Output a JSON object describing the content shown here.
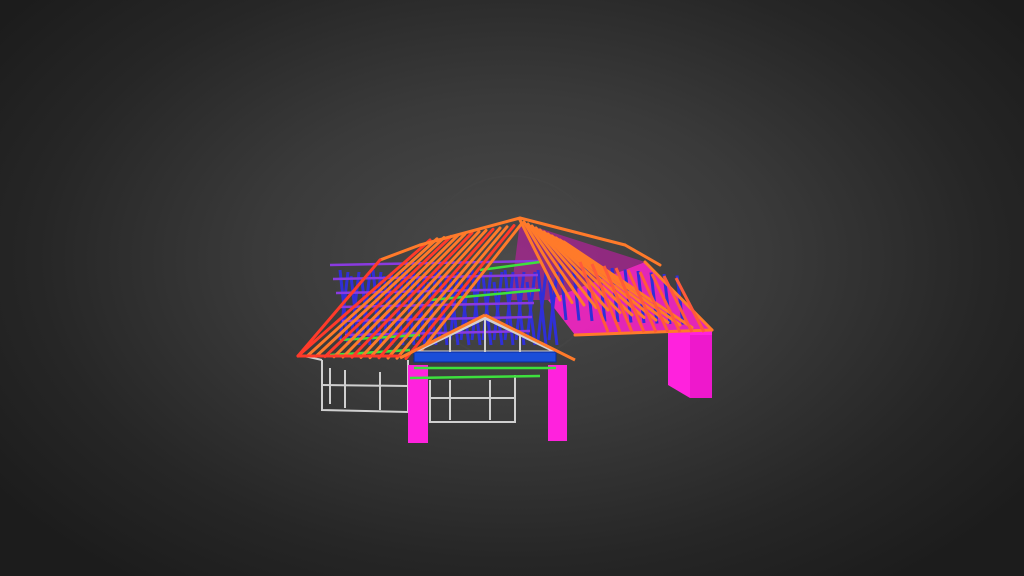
{
  "viewer": {
    "background_colors": [
      "#4a4a4a",
      "#262626"
    ],
    "model": {
      "subject": "3d-roof-truss-frame-model",
      "colors": {
        "rafters": "#ff7a2a",
        "rafters_red": "#ff3a2a",
        "webs": "#2f2fd8",
        "purlins": "#8a3ae0",
        "wall_frame": "#d0d0d0",
        "ties": "#3de03d",
        "posts": "#ff22dd",
        "soffit": "#ff22cc",
        "fascia_blue": "#1a4ed8"
      }
    }
  }
}
